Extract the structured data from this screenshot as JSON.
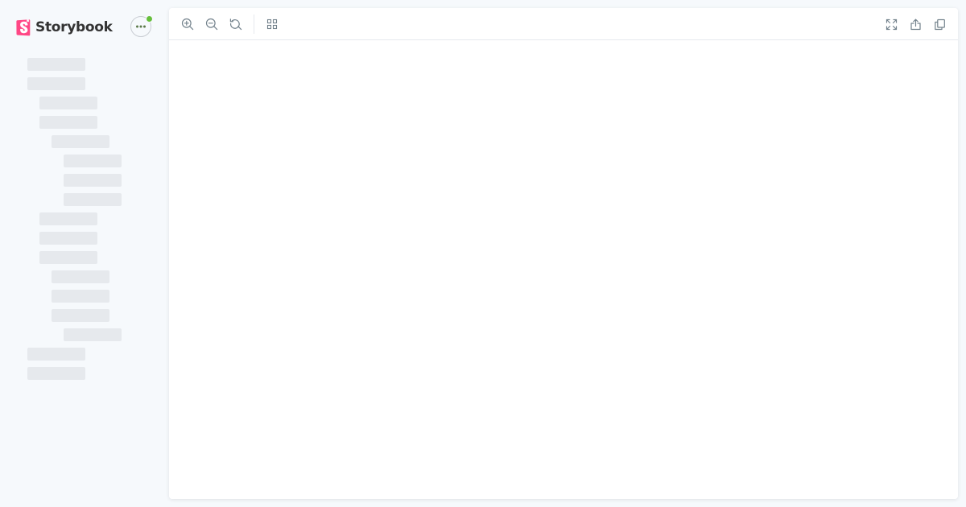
{
  "app": {
    "name": "Storybook",
    "brand_color": "#FF4785",
    "status_color": "#66BF3C"
  },
  "sidebar": {
    "menu_icon": "ellipsis-icon",
    "tree_state": "loading",
    "skeleton_rows": 17
  },
  "toolbar": {
    "left_tools": [
      "zoom-in-icon",
      "zoom-out-icon",
      "reset-zoom-icon",
      "grid-icon"
    ],
    "right_tools": [
      "fullscreen-icon",
      "share-icon",
      "copy-icon"
    ]
  }
}
